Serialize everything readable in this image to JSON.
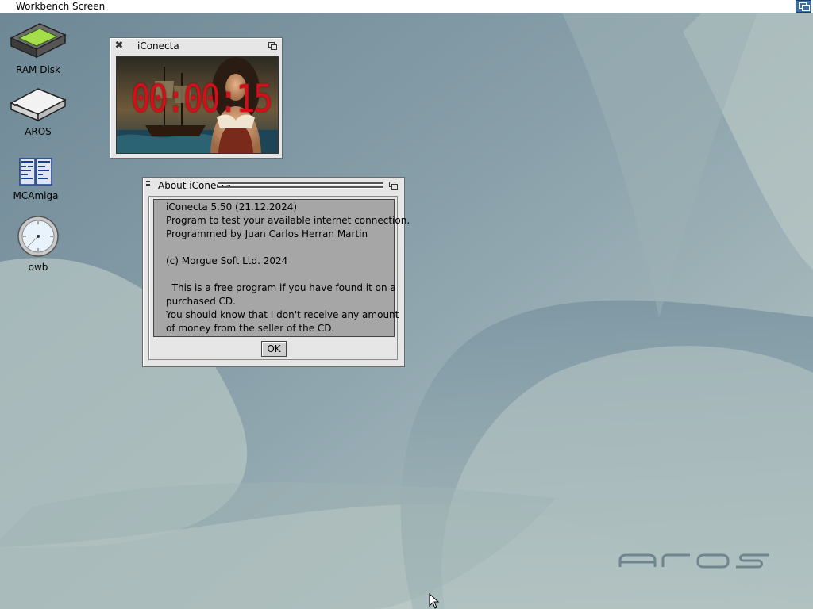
{
  "screen": {
    "title": "Workbench Screen"
  },
  "desktop_icons": [
    {
      "label": "RAM Disk",
      "icon": "ram-disk-icon"
    },
    {
      "label": "AROS",
      "icon": "hard-drive-icon"
    },
    {
      "label": "MCAmiga",
      "icon": "file-manager-icon"
    },
    {
      "label": "owb",
      "icon": "compass-browser-icon"
    }
  ],
  "clock_window": {
    "title": "iConecta",
    "timer": "00:00:15"
  },
  "about_window": {
    "title": "About iConecta",
    "lines": [
      "iConecta 5.50 (21.12.2024)",
      "Program to test your available internet connection.",
      "Programmed by Juan Carlos Herran Martin",
      "",
      "(c) Morgue Soft Ltd. 2024",
      "",
      "  This is a free program if you have found it on a",
      "purchased CD.",
      "You should know that I don't receive any amount",
      "of money from the seller of the CD."
    ],
    "ok_label": "OK"
  },
  "colors": {
    "timer": "#d1101a",
    "screenbar_gadget": "#3b6ea0",
    "text_area": "#a6a6a6"
  }
}
